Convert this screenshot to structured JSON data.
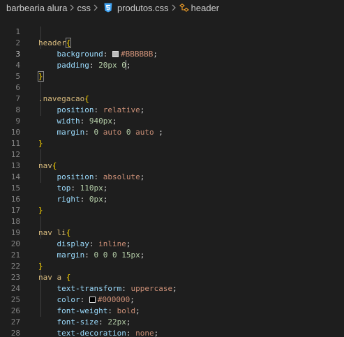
{
  "breadcrumb": {
    "folder1": "barbearia alura",
    "folder2": "css",
    "file": "produtos.css",
    "symbol": "header"
  },
  "colors": {
    "swatch_bbbbbb": "#BBBBBB",
    "swatch_000000": "#000000",
    "css_icon": "#42a5f5",
    "symbol_icon": "#ee9d28"
  },
  "editor": {
    "active_line": 3,
    "line_numbers": [
      "1",
      "2",
      "3",
      "4",
      "5",
      "6",
      "7",
      "8",
      "9",
      "10",
      "11",
      "12",
      "13",
      "14",
      "15",
      "16",
      "17",
      "18",
      "19",
      "20",
      "21",
      "22",
      "23",
      "24",
      "25",
      "26",
      "27",
      "28"
    ],
    "code": {
      "l1_sel": "header",
      "l1_open": "{",
      "l2_prop": "background",
      "l2_colon": ": ",
      "l2_val": "#BBBBBB",
      "l2_semi": ";",
      "l3_prop": "padding",
      "l3_colon": ": ",
      "l3_val1": "20px",
      "l3_val2": "0",
      "l3_semi": ";",
      "l4_close": "}",
      "l6_sel": ".navegacao",
      "l6_open": "{",
      "l7_prop": "position",
      "l7_colon": ": ",
      "l7_val": "relative",
      "l7_semi": ";",
      "l8_prop": "width",
      "l8_colon": ": ",
      "l8_val": "940px",
      "l8_semi": ";",
      "l9_prop": "margin",
      "l9_colon": ": ",
      "l9_val1": "0",
      "l9_val2": "auto",
      "l9_val3": "0",
      "l9_val4": "auto",
      "l9_semi": " ;",
      "l10_close": "}",
      "l12_sel": "nav",
      "l12_open": "{",
      "l13_prop": "position",
      "l13_colon": ": ",
      "l13_val": "absolute",
      "l13_semi": ";",
      "l14_prop": "top",
      "l14_colon": ": ",
      "l14_val": "110px",
      "l14_semi": ";",
      "l15_prop": "right",
      "l15_colon": ": ",
      "l15_val": "0px",
      "l15_semi": ";",
      "l16_close": "}",
      "l18_sel": "nav li",
      "l18_open": "{",
      "l19_prop": "display",
      "l19_colon": ": ",
      "l19_val": "inline",
      "l19_semi": ";",
      "l20_prop": "margin",
      "l20_colon": ": ",
      "l20_val1": "0",
      "l20_val2": "0",
      "l20_val3": "0",
      "l20_val4": "15px",
      "l20_semi": ";",
      "l21_close": "}",
      "l22_sel": "nav a ",
      "l22_open": "{",
      "l23_prop": "text-transform",
      "l23_colon": ": ",
      "l23_val": "uppercase",
      "l23_semi": ";",
      "l24_prop": "color",
      "l24_colon": ": ",
      "l24_val": "#000000",
      "l24_semi": ";",
      "l25_prop": "font-weight",
      "l25_colon": ": ",
      "l25_val": "bold",
      "l25_semi": ";",
      "l26_prop": "font-size",
      "l26_colon": ": ",
      "l26_val": "22px",
      "l26_semi": ";",
      "l27_prop": "text-decoration",
      "l27_colon": ": ",
      "l27_val": "none",
      "l27_semi": ";",
      "l28_close": "}"
    }
  }
}
